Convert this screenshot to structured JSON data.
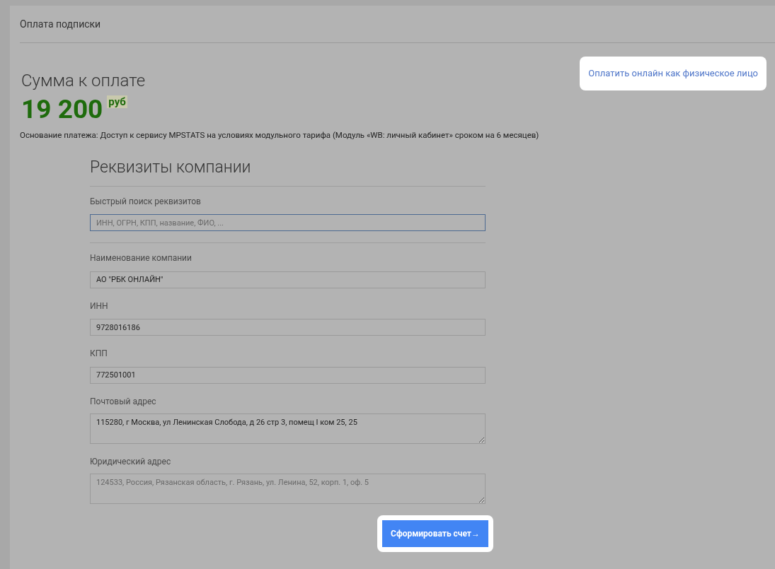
{
  "page_title": "Оплата подписки",
  "summary": {
    "heading": "Сумма к оплате",
    "amount": "19 200",
    "currency": "руб",
    "basis": "Основание платежа: Доступ к сервису MPSTATS на условиях модульного тарифа (Модуль «WB: личный кабинет» сроком на 6 месяцев)"
  },
  "online_link": "Оплатить онлайн как физическое лицо",
  "form": {
    "title": "Реквизиты компании",
    "search": {
      "label": "Быстрый поиск реквизитов",
      "placeholder": "ИНН, ОГРН, КПП, название, ФИО, ..."
    },
    "fields": [
      {
        "kind": "input",
        "label": "Наименование компании",
        "value": "АО \"РБК ОНЛАЙН\""
      },
      {
        "kind": "input",
        "label": "ИНН",
        "value": "9728016186"
      },
      {
        "kind": "input",
        "label": "КПП",
        "value": "772501001"
      },
      {
        "kind": "textarea",
        "label": "Почтовый адрес",
        "value": "115280, г Москва, ул Ленинская Слобода, д 26 стр 3, помещ I ком 25, 25"
      },
      {
        "kind": "textarea",
        "label": "Юридический адрес",
        "placeholder": "124533, Россия, Рязанская область, г. Рязань, ул. Ленина, 52, корп. 1, оф. 5"
      }
    ],
    "submit": "Сформировать счет→"
  }
}
